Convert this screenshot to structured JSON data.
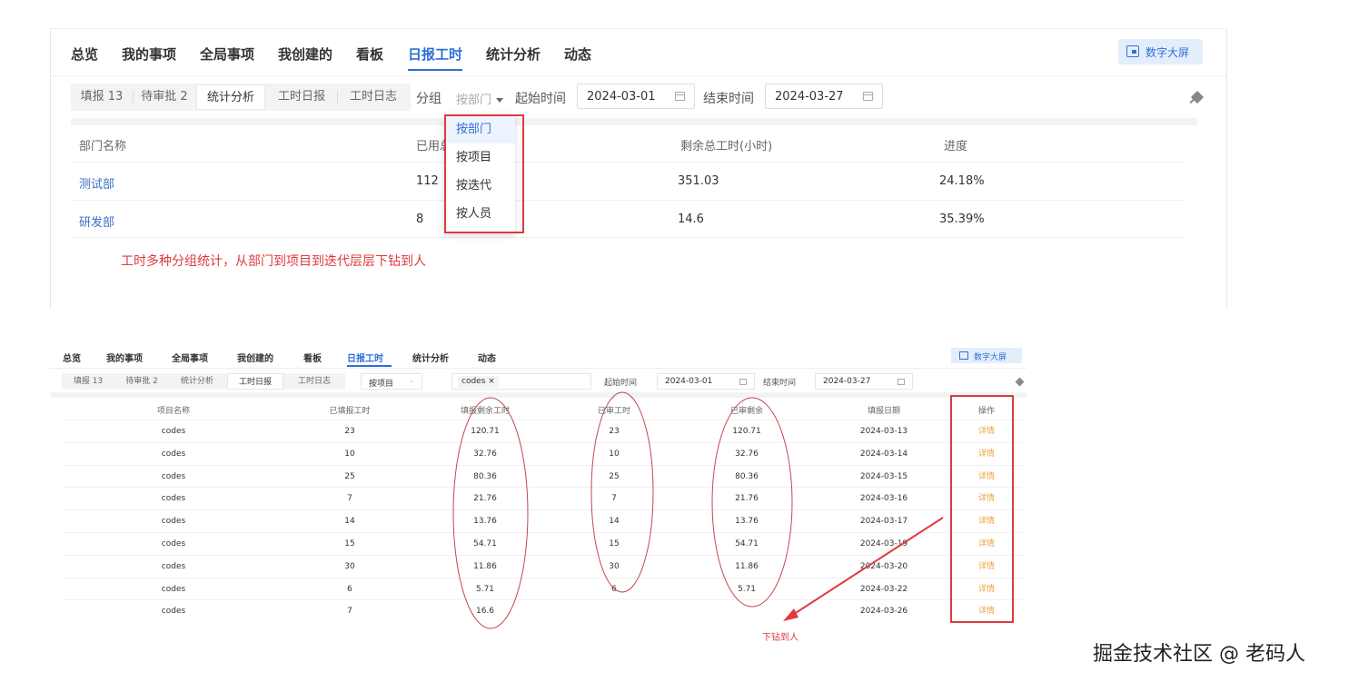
{
  "top": {
    "tabs": [
      "总览",
      "我的事项",
      "全局事项",
      "我创建的",
      "看板",
      "日报工时",
      "统计分析",
      "动态"
    ],
    "active_tab": "日报工时",
    "big_screen_button": "数字大屏",
    "segments": [
      "填报 13",
      "待审批 2",
      "统计分析",
      "工时日报",
      "工时日志"
    ],
    "active_segment": "统计分析",
    "group_label": "分组",
    "group_select": "按部门",
    "start_label": "起始时间",
    "start_date": "2024-03-01",
    "end_label": "结束时间",
    "end_date": "2024-03-27",
    "columns": [
      "部门名称",
      "已用总",
      "剩余总工时(小时)",
      "进度"
    ],
    "rows": [
      {
        "name": "测试部",
        "used": "112",
        "remaining": "351.03",
        "progress": "24.18%"
      },
      {
        "name": "研发部",
        "used": "8",
        "remaining": "14.6",
        "progress": "35.39%"
      }
    ],
    "dropdown_options": [
      "按部门",
      "按项目",
      "按迭代",
      "按人员"
    ],
    "dropdown_selected": "按部门",
    "annotation": "工时多种分组统计，从部门到项目到迭代层层下钻到人"
  },
  "bottom": {
    "tabs": [
      "总览",
      "我的事项",
      "全局事项",
      "我创建的",
      "看板",
      "日报工时",
      "统计分析",
      "动态"
    ],
    "active_tab": "日报工时",
    "big_screen_button": "数字大屏",
    "segments": [
      "填报 13",
      "待审批 2",
      "统计分析",
      "工时日报",
      "工时日志"
    ],
    "active_segment": "工时日报",
    "group_select": "按项目",
    "project_tag": "codes ×",
    "start_label": "起始时间",
    "start_date": "2024-03-01",
    "end_label": "结束时间",
    "end_date": "2024-03-27",
    "columns": [
      "项目名称",
      "已填报工时",
      "填报剩余工时",
      "已审工时",
      "已审剩余",
      "填报日期",
      "操作"
    ],
    "rows": [
      [
        "codes",
        "23",
        "120.71",
        "23",
        "120.71",
        "2024-03-13",
        "详情"
      ],
      [
        "codes",
        "10",
        "32.76",
        "10",
        "32.76",
        "2024-03-14",
        "详情"
      ],
      [
        "codes",
        "25",
        "80.36",
        "25",
        "80.36",
        "2024-03-15",
        "详情"
      ],
      [
        "codes",
        "7",
        "21.76",
        "7",
        "21.76",
        "2024-03-16",
        "详情"
      ],
      [
        "codes",
        "14",
        "13.76",
        "14",
        "13.76",
        "2024-03-17",
        "详情"
      ],
      [
        "codes",
        "15",
        "54.71",
        "15",
        "54.71",
        "2024-03-19",
        "详情"
      ],
      [
        "codes",
        "30",
        "11.86",
        "30",
        "11.86",
        "2024-03-20",
        "详情"
      ],
      [
        "codes",
        "6",
        "5.71",
        "6",
        "5.71",
        "2024-03-22",
        "详情"
      ],
      [
        "codes",
        "7",
        "16.6",
        "",
        "",
        "2024-03-26",
        "详情"
      ]
    ],
    "annotation": "下钻到人"
  },
  "watermark": "掘金技术社区 @ 老码人",
  "colors": {
    "accent": "#2f6fd6",
    "annotation_red": "#e0393e",
    "link": "#3870c8",
    "detail_orange": "#e8a33d"
  }
}
